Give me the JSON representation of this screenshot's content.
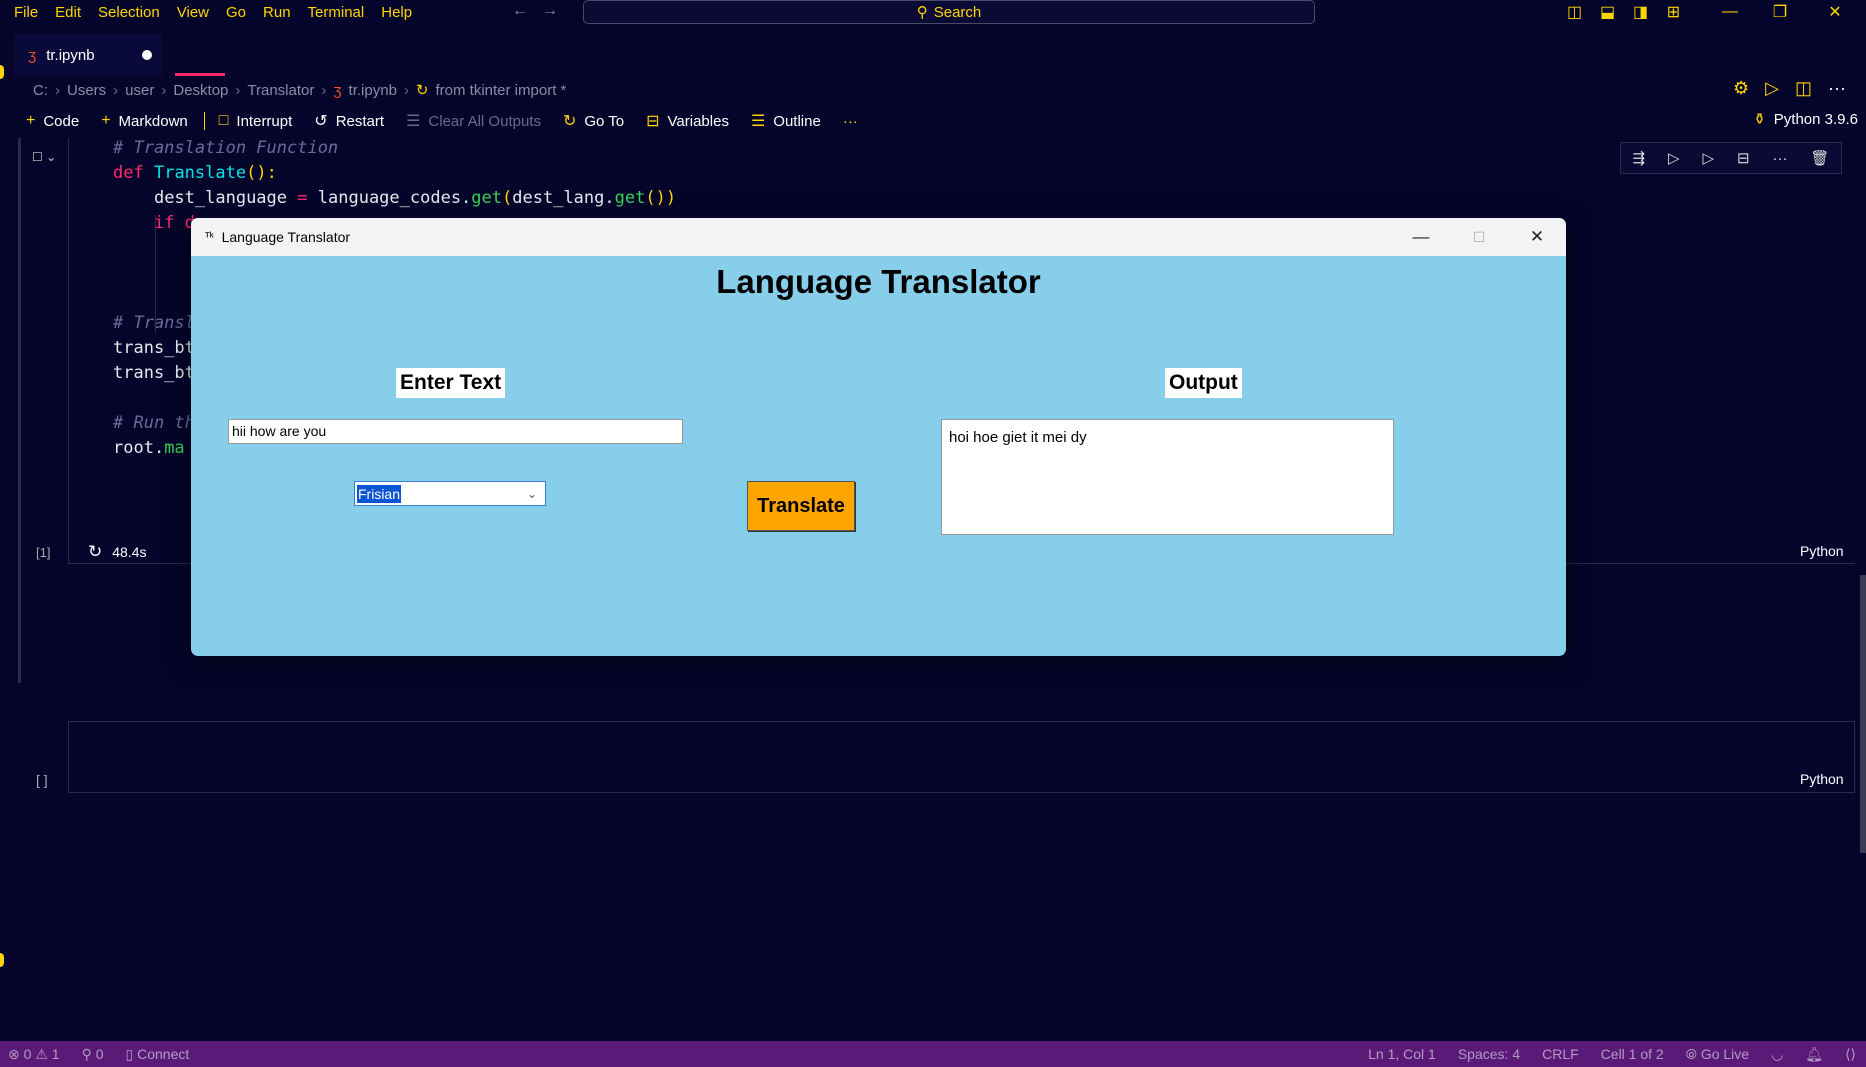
{
  "menu": [
    "File",
    "Edit",
    "Selection",
    "View",
    "Go",
    "Run",
    "Terminal",
    "Help"
  ],
  "search": {
    "label": "Search"
  },
  "tab": {
    "label": "tr.ipynb"
  },
  "breadcrumb": [
    "C:",
    "Users",
    "user",
    "Desktop",
    "Translator",
    "tr.ipynb",
    "from tkinter import *"
  ],
  "toolbar": {
    "code": "Code",
    "markdown": "Markdown",
    "interrupt": "Interrupt",
    "restart": "Restart",
    "clear": "Clear All Outputs",
    "goto": "Go To",
    "variables": "Variables",
    "outline": "Outline",
    "more": "···"
  },
  "kernel": "Python 3.9.6",
  "code": {
    "l1": "# Translation Function",
    "l2_kw": "def",
    "l2_fn": "Translate",
    "l2_rest": "():",
    "l3_a": "dest_language",
    "l3_op": "=",
    "l3_b": "language_codes.",
    "l3_m1": "get",
    "l3_c": "dest_lang.",
    "l3_m2": "get",
    "l4": "if d",
    "l8": "# Transl",
    "l9": "trans_bt",
    "l10": "trans_bt",
    "l12": "# Run th",
    "l13_a": "root.",
    "l13_b": "ma"
  },
  "cell1": {
    "index": "[1]",
    "time": "48.4s",
    "lang": "Python"
  },
  "cell2": {
    "index": "[ ]",
    "lang": "Python"
  },
  "tkinter": {
    "window_title": "Language Translator",
    "heading": "Language Translator",
    "enter_label": "Enter Text",
    "output_label": "Output",
    "input_value": "hii how are you",
    "language": "Frisian",
    "button": "Translate",
    "output_value": "hoi hoe giet it mei dy"
  },
  "status": {
    "errors": "0",
    "warnings": "1",
    "ports": "0",
    "connect": "Connect",
    "position": "Ln 1, Col 1",
    "spaces": "Spaces: 4",
    "eol": "CRLF",
    "cell": "Cell 1 of 2",
    "golive": "Go Live"
  },
  "colors": {
    "accent": "#ffd500",
    "background": "#05052b",
    "statusbar": "#5a1a78",
    "tk_bg": "#87ceeb",
    "button": "#ffa500"
  }
}
